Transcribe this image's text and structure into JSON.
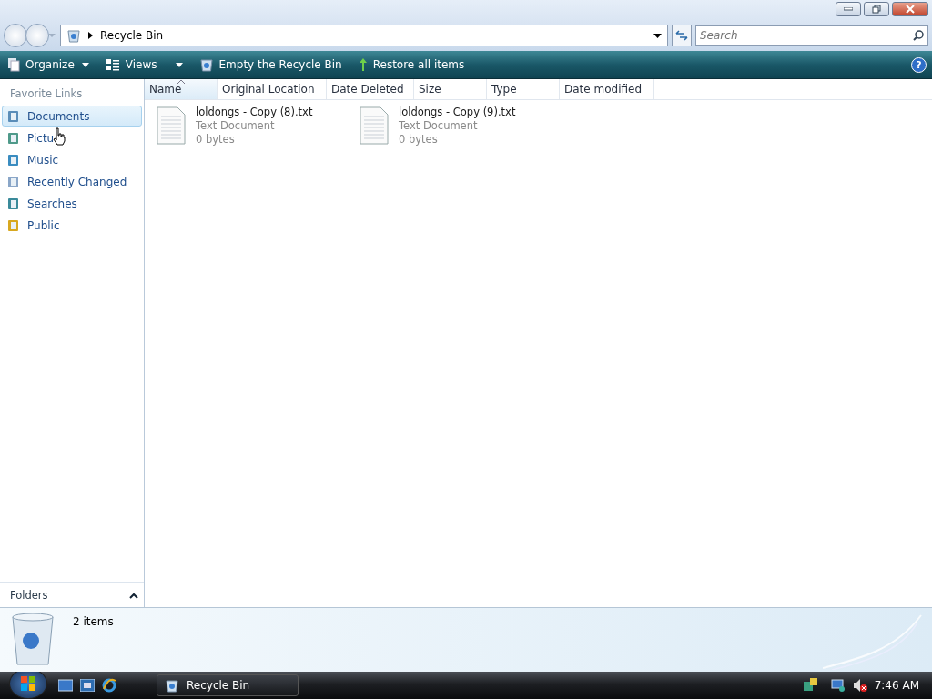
{
  "address": {
    "path": "Recycle Bin"
  },
  "search": {
    "placeholder": "Search"
  },
  "toolbar": {
    "buttons": [
      {
        "label": "Organize",
        "kind": "menu"
      },
      {
        "label": "Views",
        "kind": "menu"
      },
      {
        "label": "Empty the Recycle Bin",
        "kind": "action"
      },
      {
        "label": "Restore all items",
        "kind": "action"
      }
    ],
    "help": "?"
  },
  "sidebar": {
    "title": "Favorite Links",
    "items": [
      {
        "label": "Documents",
        "selected": true
      },
      {
        "label": "Pictu",
        "selected": false
      },
      {
        "label": "Music",
        "selected": false
      },
      {
        "label": "Recently Changed",
        "selected": false
      },
      {
        "label": "Searches",
        "selected": false
      },
      {
        "label": "Public",
        "selected": false
      }
    ],
    "folders": "Folders"
  },
  "columns": [
    {
      "label": "Name",
      "sorted": true
    },
    {
      "label": "Original Location",
      "sorted": false
    },
    {
      "label": "Date Deleted",
      "sorted": false
    },
    {
      "label": "Size",
      "sorted": false
    },
    {
      "label": "Type",
      "sorted": false
    },
    {
      "label": "Date modified",
      "sorted": false
    }
  ],
  "files": [
    {
      "name": "loldongs - Copy (8).txt",
      "type": "Text Document",
      "size": "0 bytes"
    },
    {
      "name": "loldongs - Copy (9).txt",
      "type": "Text Document",
      "size": "0 bytes"
    }
  ],
  "details": {
    "count": "2 items"
  },
  "taskbar": {
    "windows": [
      {
        "label": "Recycle Bin",
        "selected": true
      }
    ],
    "clock": "7:46 AM"
  }
}
